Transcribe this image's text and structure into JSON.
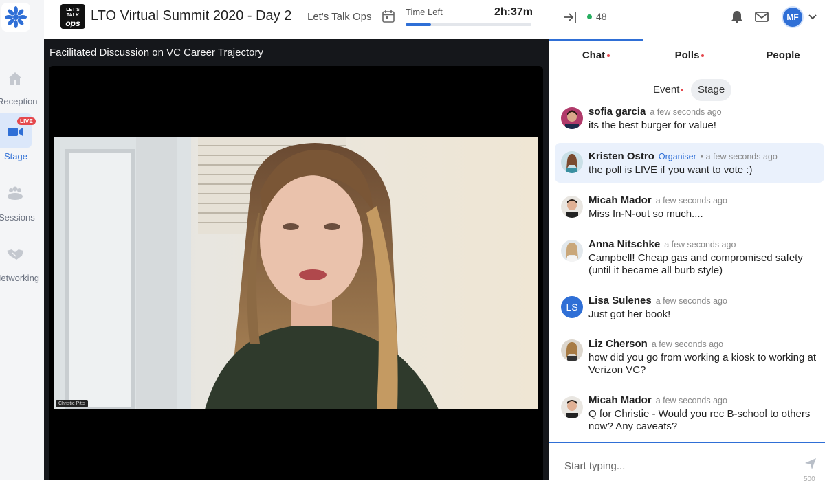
{
  "rail": {
    "items": [
      {
        "label": "Reception",
        "icon": "home-icon"
      },
      {
        "label": "Stage",
        "icon": "video-camera-icon",
        "badge": "LIVE"
      },
      {
        "label": "Sessions",
        "icon": "people-group-icon"
      },
      {
        "label": "Networking",
        "icon": "handshake-icon"
      }
    ]
  },
  "header": {
    "logo_text_top": "LET'S TALK",
    "logo_text_bottom": "ops",
    "event_title": "LTO Virtual Summit 2020 - Day 2",
    "organizer": "Let's Talk Ops",
    "time_left_label": "Time Left",
    "time_left_value": "2h:37m",
    "time_progress": 0.2
  },
  "stage": {
    "session_title": "Facilitated Discussion on VC Career Trajectory",
    "speaker_name_tag": "Christie Pitts"
  },
  "panel": {
    "online_count": "48",
    "user_initials": "MF",
    "tabs": [
      {
        "label": "Chat",
        "has_dot": true
      },
      {
        "label": "Polls",
        "has_dot": true
      },
      {
        "label": "People",
        "has_dot": false
      }
    ],
    "subtabs": [
      {
        "label": "Event",
        "has_dot": true
      },
      {
        "label": "Stage",
        "has_dot": false
      }
    ],
    "messages": [
      {
        "name": "sofia garcia",
        "time": "a few seconds ago",
        "text": "its the best burger for value!"
      },
      {
        "name": "Kristen Ostro",
        "role": "Organiser",
        "time": "• a few seconds ago",
        "text": "the poll is LIVE if you want to vote :)"
      },
      {
        "name": "Micah Mador",
        "time": "a few seconds ago",
        "text": "Miss In-N-out so much...."
      },
      {
        "name": "Anna Nitschke",
        "time": "a few seconds ago",
        "text": "Campbell! Cheap gas and compromised safety (until it became all burb style)"
      },
      {
        "name": "Lisa Sulenes",
        "initials": "LS",
        "time": "a few seconds ago",
        "text": "Just got her book!"
      },
      {
        "name": "Liz Cherson",
        "time": "a few seconds ago",
        "text": "how did you go from working a kiosk to working at Verizon VC?"
      },
      {
        "name": "Micah Mador",
        "time": "a few seconds ago",
        "text": "Q for Christie - Would you rec B-school to others now? Any caveats?"
      }
    ],
    "composer": {
      "placeholder": "Start typing...",
      "char_limit": "500"
    }
  },
  "colors": {
    "accent": "#2f6fd6",
    "live": "#e5484d",
    "online": "#27ae60"
  }
}
